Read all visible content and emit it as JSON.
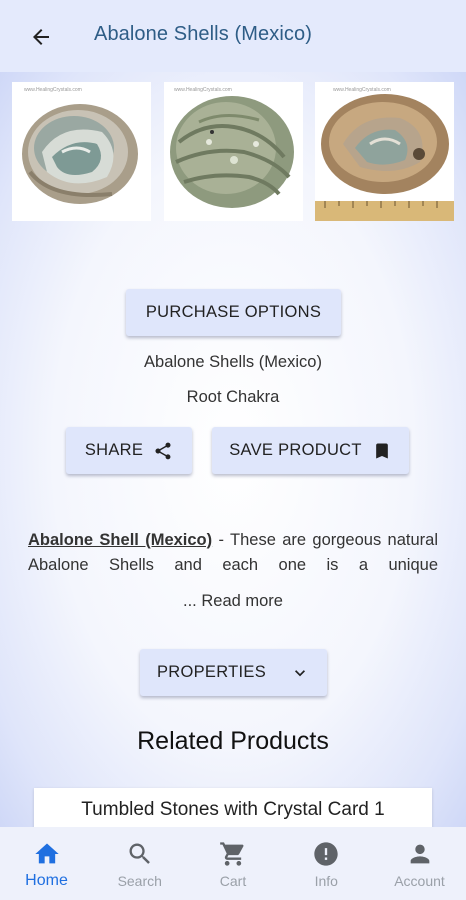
{
  "header": {
    "title": "Abalone Shells (Mexico)",
    "back_icon": "arrow-left-icon"
  },
  "gallery": {
    "watermark": "www.HealingCrystals.com",
    "images": [
      {
        "name": "abalone-shell-inside"
      },
      {
        "name": "abalone-shell-outside"
      },
      {
        "name": "abalone-shell-with-ruler"
      }
    ]
  },
  "actions": {
    "purchase_label": "PURCHASE OPTIONS",
    "share_label": "SHARE",
    "save_label": "SAVE PRODUCT",
    "properties_label": "PROPERTIES"
  },
  "product": {
    "name": "Abalone Shells (Mexico)",
    "chakra": "Root Chakra"
  },
  "description": {
    "lead": "Abalone Shell (Mexico)",
    "text": " - These are gorgeous nat­ural Abalone Shells and each one is a unique",
    "read_more": "... Read more"
  },
  "related": {
    "title": "Related Products",
    "items": [
      {
        "label": "Tumbled Stones with Crystal Card 1"
      }
    ]
  },
  "bottom_nav": {
    "items": [
      {
        "label": "Home",
        "icon": "home-icon",
        "active": true
      },
      {
        "label": "Search",
        "icon": "search-icon",
        "active": false
      },
      {
        "label": "Cart",
        "icon": "cart-icon",
        "active": false
      },
      {
        "label": "Info",
        "icon": "info-icon",
        "active": false
      },
      {
        "label": "Account",
        "icon": "account-icon",
        "active": false
      }
    ]
  },
  "colors": {
    "accent": "#1f6fe0",
    "title": "#2e5d86",
    "button_bg": "#dfe6fb"
  }
}
